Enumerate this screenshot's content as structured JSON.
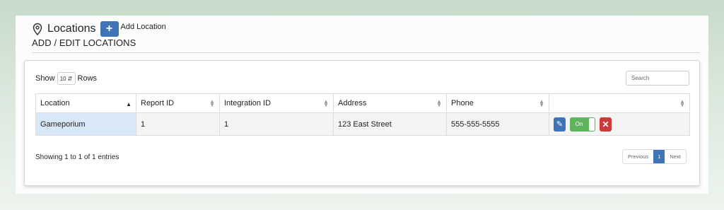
{
  "header": {
    "title": "Locations",
    "add_button_icon": "+",
    "add_label": "Add Location",
    "subtitle": "ADD / EDIT LOCATIONS"
  },
  "controls": {
    "show_label": "Show",
    "rows_value": "10",
    "rows_label": "Rows",
    "search_placeholder": "Search"
  },
  "table": {
    "columns": [
      "Location",
      "Report ID",
      "Integration ID",
      "Address",
      "Phone",
      ""
    ],
    "rows": [
      {
        "location": "Gameporium",
        "report_id": "1",
        "integration_id": "1",
        "address": "123 East Street",
        "phone": "555-555-5555",
        "toggle": "On"
      }
    ]
  },
  "footer": {
    "info": "Showing 1 to 1 of 1 entries",
    "previous": "Previous",
    "page": "1",
    "next": "Next"
  },
  "colors": {
    "primary": "#3f74b8",
    "success": "#5fb35f",
    "danger": "#cc3b3b",
    "selected_cell": "#d8e8f8"
  }
}
